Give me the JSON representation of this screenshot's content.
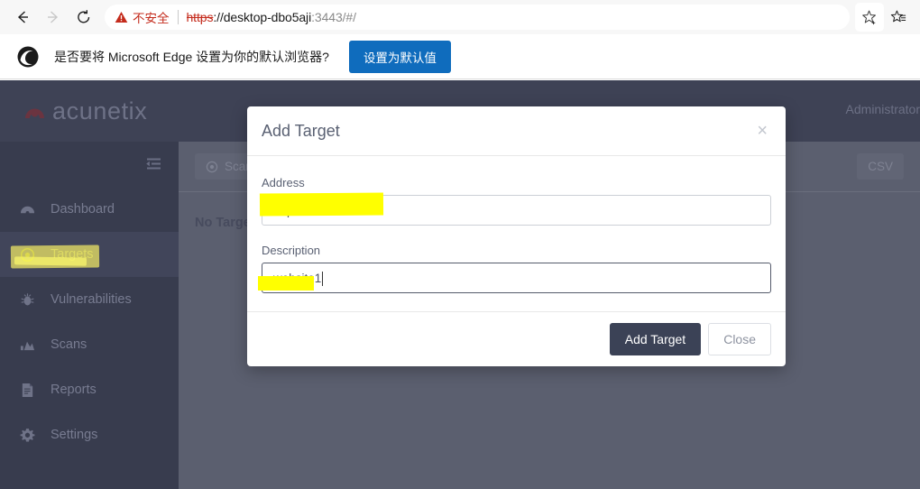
{
  "browser": {
    "back_label": "Back",
    "forward_label": "Forward",
    "refresh_label": "Refresh",
    "security_label": "不安全",
    "url_scheme": "https",
    "url_separator": "://",
    "url_host": "desktop-dbo5aji",
    "url_rest": ":3443/#/",
    "favorite_label": "Add to favorites",
    "collections_label": "Collections"
  },
  "edge_bar": {
    "message": "是否要将 Microsoft Edge 设置为你的默认浏览器?",
    "button_label": "设置为默认值",
    "button_color": "#0f6cbd"
  },
  "app": {
    "brand": "acunetix",
    "user": "Administrator"
  },
  "sidebar": {
    "items": [
      {
        "label": "Dashboard",
        "icon": "dashboard-icon",
        "active": false
      },
      {
        "label": "Targets",
        "icon": "target-icon",
        "active": true
      },
      {
        "label": "Vulnerabilities",
        "icon": "bug-icon",
        "active": false
      },
      {
        "label": "Scans",
        "icon": "chart-icon",
        "active": false
      },
      {
        "label": "Reports",
        "icon": "document-icon",
        "active": false
      },
      {
        "label": "Settings",
        "icon": "gear-icon",
        "active": false
      }
    ]
  },
  "content": {
    "scan_button_label": "Scan",
    "csv_button_label": "CSV",
    "empty_message": "No Targets"
  },
  "modal": {
    "title": "Add Target",
    "close_label": "×",
    "address_label": "Address",
    "address_value": "http://192.168.43.79",
    "address_placeholder": "http://",
    "description_label": "Description",
    "description_value": "website1",
    "description_placeholder": "",
    "submit_label": "Add Target",
    "cancel_label": "Close",
    "submit_color": "#3b4256"
  },
  "annotations": {
    "highlight_color": "#ffff00",
    "targets_highlight_color": "#eee210"
  }
}
